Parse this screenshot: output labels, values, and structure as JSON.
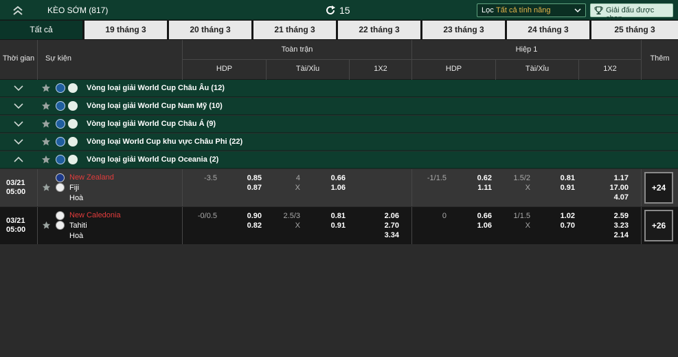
{
  "topbar": {
    "title": "KÈO SỚM (817)",
    "refresh_count": "15",
    "filter_label": "Lọc",
    "filter_value": "Tất cả tính năng",
    "league_button": "Giải đấu được chọn"
  },
  "tabs": [
    {
      "label": "Tất cả",
      "active": true
    },
    {
      "label": "19 tháng 3"
    },
    {
      "label": "20 tháng 3"
    },
    {
      "label": "21 tháng 3"
    },
    {
      "label": "22 tháng 3"
    },
    {
      "label": "23 tháng 3"
    },
    {
      "label": "24 tháng 3"
    },
    {
      "label": "25 tháng 3"
    }
  ],
  "header": {
    "time": "Thời gian",
    "event": "Sự kiện",
    "full_match": "Toàn trận",
    "half": "Hiệp 1",
    "more": "Thêm",
    "hdp": "HDP",
    "ou": "Tài/Xỉu",
    "x12": "1X2"
  },
  "leagues": [
    {
      "name": "Vòng loại giải World Cup Châu Âu (12)",
      "expanded": false
    },
    {
      "name": "Vòng loại giải World Cup Nam Mỹ (10)",
      "expanded": false
    },
    {
      "name": "Vòng loại giải World Cup Châu Á (9)",
      "expanded": false
    },
    {
      "name": "Vòng loại World Cup khu vực Châu Phi (22)",
      "expanded": false
    },
    {
      "name": "Vòng loại giải World Cup Oceania (2)",
      "expanded": true
    }
  ],
  "matches": [
    {
      "date": "03/21",
      "time": "05:00",
      "home": "New Zealand",
      "away": "Fiji",
      "draw": "Hoà",
      "ft": {
        "hdp_line": "-3.5",
        "hdp_home": "0.85",
        "hdp_away": "0.87",
        "ou_line": "4",
        "ou_x": "X",
        "ou_over": "0.66",
        "ou_under": "1.06",
        "x12_1": "",
        "x12_2": "",
        "x12_x": ""
      },
      "ht": {
        "hdp_line": "-1/1.5",
        "hdp_home": "0.62",
        "hdp_away": "1.11",
        "ou_line": "1.5/2",
        "ou_x": "X",
        "ou_over": "0.81",
        "ou_under": "0.91",
        "x12_1": "1.17",
        "x12_2": "17.00",
        "x12_x": "4.07"
      },
      "more": "+24"
    },
    {
      "date": "03/21",
      "time": "05:00",
      "home": "New Caledonia",
      "away": "Tahiti",
      "draw": "Hoà",
      "ft": {
        "hdp_line": "-0/0.5",
        "hdp_home": "0.90",
        "hdp_away": "0.82",
        "ou_line": "2.5/3",
        "ou_x": "X",
        "ou_over": "0.81",
        "ou_under": "0.91",
        "x12_1": "2.06",
        "x12_2": "2.70",
        "x12_x": "3.34"
      },
      "ht": {
        "hdp_line": "0",
        "hdp_home": "0.66",
        "hdp_away": "1.06",
        "ou_line": "1/1.5",
        "ou_x": "X",
        "ou_over": "1.02",
        "ou_under": "0.70",
        "x12_1": "2.59",
        "x12_2": "3.23",
        "x12_x": "2.14"
      },
      "more": "+26"
    }
  ],
  "colors": {
    "league_bg": "#0e3d2e",
    "home_team": "#e23c3c",
    "filter_value": "#e6b54a"
  }
}
